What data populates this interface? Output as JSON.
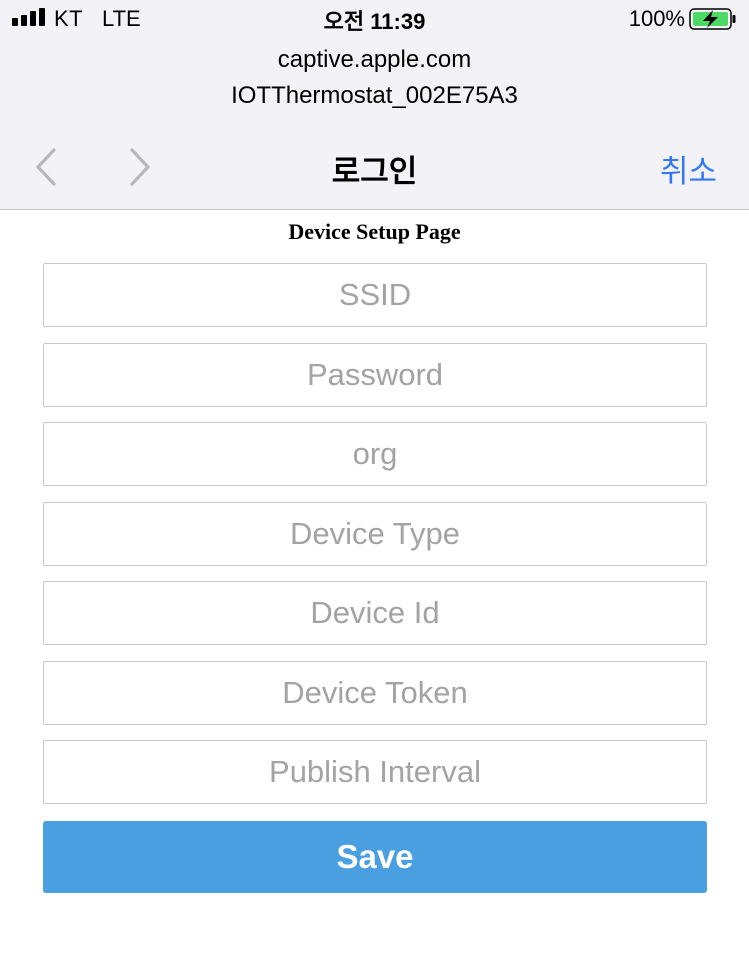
{
  "status_bar": {
    "carrier": "KT",
    "network": "LTE",
    "time": "오전 11:39",
    "battery_percent": "100%",
    "battery_level": 1.0,
    "battery_charging": true,
    "signal_icon": "signal-bars-icon",
    "battery_icon": "battery-charging-icon"
  },
  "browser": {
    "host": "captive.apple.com",
    "network_name": "IOTThermostat_002E75A3"
  },
  "nav": {
    "back_icon": "chevron-left-icon",
    "forward_icon": "chevron-right-icon",
    "title": "로그인",
    "cancel_label": "취소",
    "accent_color": "#3478f6"
  },
  "form": {
    "heading": "Device Setup Page",
    "fields": [
      {
        "name": "ssid",
        "placeholder": "SSID",
        "value": ""
      },
      {
        "name": "password",
        "placeholder": "Password",
        "value": ""
      },
      {
        "name": "org",
        "placeholder": "org",
        "value": ""
      },
      {
        "name": "device-type",
        "placeholder": "Device Type",
        "value": ""
      },
      {
        "name": "device-id",
        "placeholder": "Device Id",
        "value": ""
      },
      {
        "name": "device-token",
        "placeholder": "Device Token",
        "value": ""
      },
      {
        "name": "publish-interval",
        "placeholder": "Publish Interval",
        "value": ""
      }
    ],
    "save_label": "Save",
    "save_color": "#4a9fe0"
  }
}
